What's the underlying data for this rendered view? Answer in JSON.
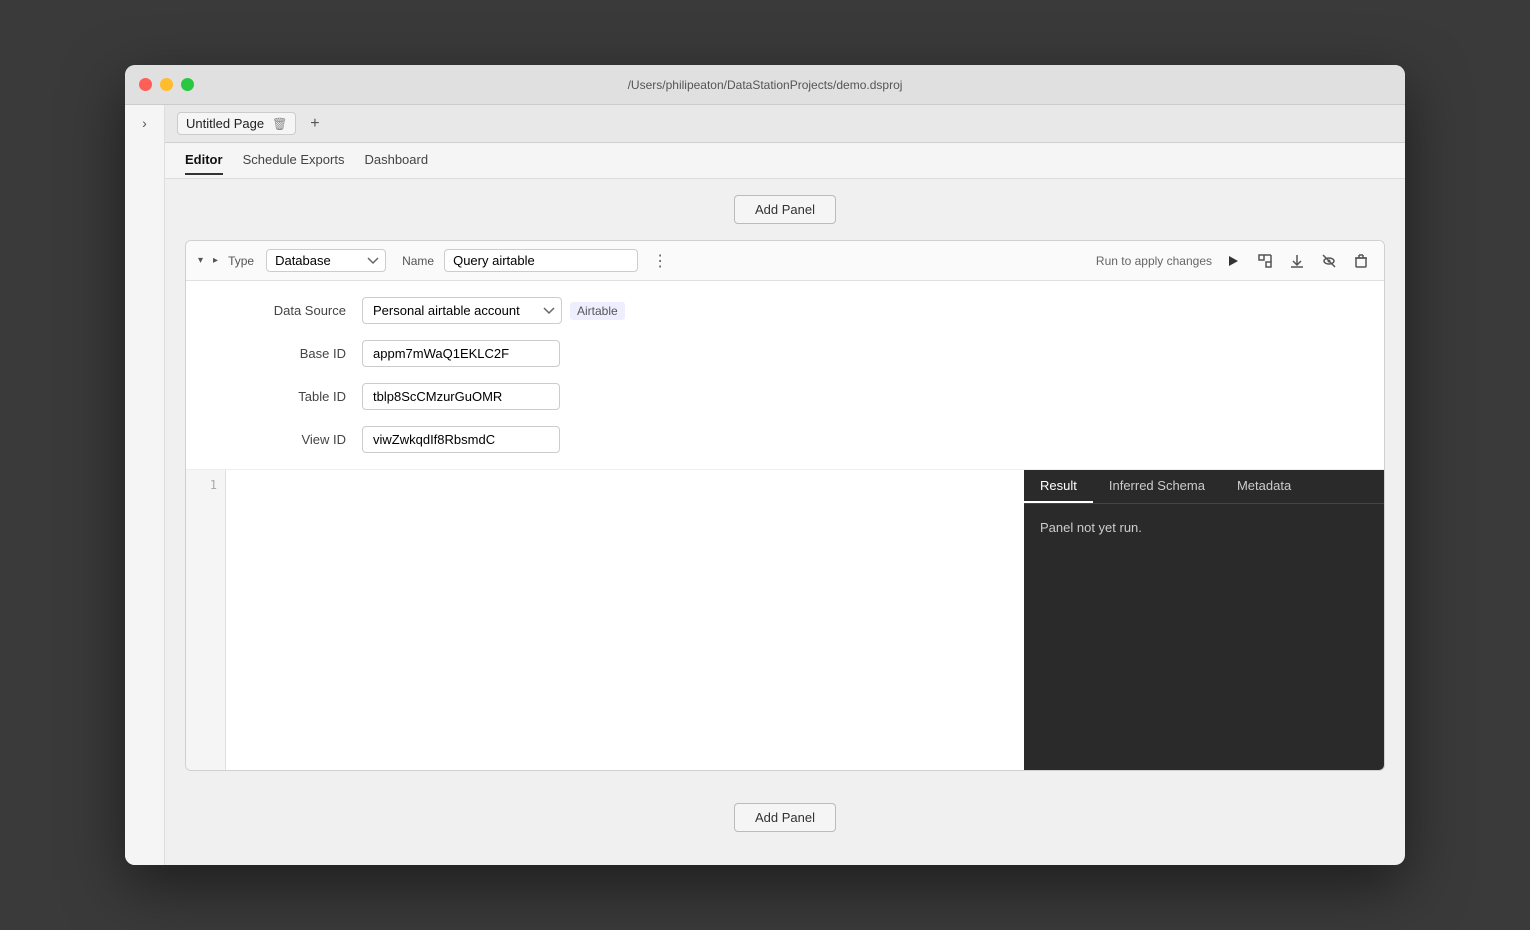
{
  "titlebar": {
    "path": "/Users/philipeaton/DataStationProjects/demo.dsproj"
  },
  "tabs": {
    "pages": [
      {
        "name": "Untitled Page"
      }
    ],
    "add_label": "+"
  },
  "nav": {
    "items": [
      {
        "label": "Editor",
        "active": true
      },
      {
        "label": "Schedule Exports",
        "active": false
      },
      {
        "label": "Dashboard",
        "active": false
      }
    ]
  },
  "add_panel_top": "Add Panel",
  "add_panel_bottom": "Add Panel",
  "panel": {
    "type_label": "Type",
    "type_value": "Database",
    "name_label": "Name",
    "name_value": "Query airtable",
    "run_hint": "Run to apply changes",
    "data_source_label": "Data Source",
    "data_source_value": "Personal airtable account",
    "data_source_tag": "Airtable",
    "base_id_label": "Base ID",
    "base_id_value": "appm7mWaQ1EKLC2F",
    "table_id_label": "Table ID",
    "table_id_value": "tblp8ScCMzurGuOMR",
    "view_id_label": "View ID",
    "view_id_value": "viwZwkqdIf8RbsmdC",
    "result_tabs": [
      {
        "label": "Result",
        "active": true
      },
      {
        "label": "Inferred Schema",
        "active": false
      },
      {
        "label": "Metadata",
        "active": false
      }
    ],
    "result_message": "Panel not yet run.",
    "line_number": "1"
  },
  "icons": {
    "chevron_right": "›",
    "chevron_up": "▲",
    "chevron_down": "▼",
    "collapse": "▾",
    "expand": "▸",
    "trash": "🗑",
    "play": "▶",
    "fullscreen": "⛶",
    "download": "⬇",
    "eye_off": "👁",
    "delete": "✕",
    "more": "⋮"
  }
}
